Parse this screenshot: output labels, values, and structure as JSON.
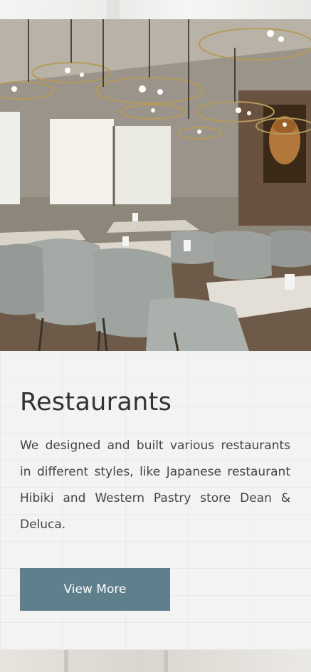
{
  "slider": {
    "dots": [
      {
        "label": "slide-1",
        "active": false
      },
      {
        "label": "slide-2",
        "active": true
      }
    ]
  },
  "section": {
    "title": "Restaurants",
    "description": "We designed and built various restaurants in different styles, like Japanese restaurant Hibiki and Western Pastry store Dean & Deluca.",
    "button_label": "View More"
  },
  "colors": {
    "button": "#5f7f8c",
    "title_text": "#333333",
    "body_text": "#444444"
  }
}
